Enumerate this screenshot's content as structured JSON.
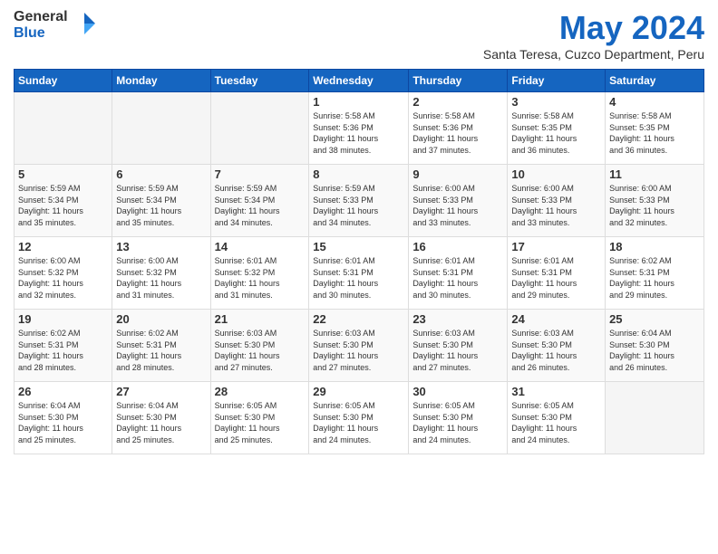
{
  "header": {
    "logo_line1": "General",
    "logo_line2": "Blue",
    "month_title": "May 2024",
    "location": "Santa Teresa, Cuzco Department, Peru"
  },
  "days_of_week": [
    "Sunday",
    "Monday",
    "Tuesday",
    "Wednesday",
    "Thursday",
    "Friday",
    "Saturday"
  ],
  "weeks": [
    [
      {
        "day": "",
        "info": ""
      },
      {
        "day": "",
        "info": ""
      },
      {
        "day": "",
        "info": ""
      },
      {
        "day": "1",
        "info": "Sunrise: 5:58 AM\nSunset: 5:36 PM\nDaylight: 11 hours\nand 38 minutes."
      },
      {
        "day": "2",
        "info": "Sunrise: 5:58 AM\nSunset: 5:36 PM\nDaylight: 11 hours\nand 37 minutes."
      },
      {
        "day": "3",
        "info": "Sunrise: 5:58 AM\nSunset: 5:35 PM\nDaylight: 11 hours\nand 36 minutes."
      },
      {
        "day": "4",
        "info": "Sunrise: 5:58 AM\nSunset: 5:35 PM\nDaylight: 11 hours\nand 36 minutes."
      }
    ],
    [
      {
        "day": "5",
        "info": "Sunrise: 5:59 AM\nSunset: 5:34 PM\nDaylight: 11 hours\nand 35 minutes."
      },
      {
        "day": "6",
        "info": "Sunrise: 5:59 AM\nSunset: 5:34 PM\nDaylight: 11 hours\nand 35 minutes."
      },
      {
        "day": "7",
        "info": "Sunrise: 5:59 AM\nSunset: 5:34 PM\nDaylight: 11 hours\nand 34 minutes."
      },
      {
        "day": "8",
        "info": "Sunrise: 5:59 AM\nSunset: 5:33 PM\nDaylight: 11 hours\nand 34 minutes."
      },
      {
        "day": "9",
        "info": "Sunrise: 6:00 AM\nSunset: 5:33 PM\nDaylight: 11 hours\nand 33 minutes."
      },
      {
        "day": "10",
        "info": "Sunrise: 6:00 AM\nSunset: 5:33 PM\nDaylight: 11 hours\nand 33 minutes."
      },
      {
        "day": "11",
        "info": "Sunrise: 6:00 AM\nSunset: 5:33 PM\nDaylight: 11 hours\nand 32 minutes."
      }
    ],
    [
      {
        "day": "12",
        "info": "Sunrise: 6:00 AM\nSunset: 5:32 PM\nDaylight: 11 hours\nand 32 minutes."
      },
      {
        "day": "13",
        "info": "Sunrise: 6:00 AM\nSunset: 5:32 PM\nDaylight: 11 hours\nand 31 minutes."
      },
      {
        "day": "14",
        "info": "Sunrise: 6:01 AM\nSunset: 5:32 PM\nDaylight: 11 hours\nand 31 minutes."
      },
      {
        "day": "15",
        "info": "Sunrise: 6:01 AM\nSunset: 5:31 PM\nDaylight: 11 hours\nand 30 minutes."
      },
      {
        "day": "16",
        "info": "Sunrise: 6:01 AM\nSunset: 5:31 PM\nDaylight: 11 hours\nand 30 minutes."
      },
      {
        "day": "17",
        "info": "Sunrise: 6:01 AM\nSunset: 5:31 PM\nDaylight: 11 hours\nand 29 minutes."
      },
      {
        "day": "18",
        "info": "Sunrise: 6:02 AM\nSunset: 5:31 PM\nDaylight: 11 hours\nand 29 minutes."
      }
    ],
    [
      {
        "day": "19",
        "info": "Sunrise: 6:02 AM\nSunset: 5:31 PM\nDaylight: 11 hours\nand 28 minutes."
      },
      {
        "day": "20",
        "info": "Sunrise: 6:02 AM\nSunset: 5:31 PM\nDaylight: 11 hours\nand 28 minutes."
      },
      {
        "day": "21",
        "info": "Sunrise: 6:03 AM\nSunset: 5:30 PM\nDaylight: 11 hours\nand 27 minutes."
      },
      {
        "day": "22",
        "info": "Sunrise: 6:03 AM\nSunset: 5:30 PM\nDaylight: 11 hours\nand 27 minutes."
      },
      {
        "day": "23",
        "info": "Sunrise: 6:03 AM\nSunset: 5:30 PM\nDaylight: 11 hours\nand 27 minutes."
      },
      {
        "day": "24",
        "info": "Sunrise: 6:03 AM\nSunset: 5:30 PM\nDaylight: 11 hours\nand 26 minutes."
      },
      {
        "day": "25",
        "info": "Sunrise: 6:04 AM\nSunset: 5:30 PM\nDaylight: 11 hours\nand 26 minutes."
      }
    ],
    [
      {
        "day": "26",
        "info": "Sunrise: 6:04 AM\nSunset: 5:30 PM\nDaylight: 11 hours\nand 25 minutes."
      },
      {
        "day": "27",
        "info": "Sunrise: 6:04 AM\nSunset: 5:30 PM\nDaylight: 11 hours\nand 25 minutes."
      },
      {
        "day": "28",
        "info": "Sunrise: 6:05 AM\nSunset: 5:30 PM\nDaylight: 11 hours\nand 25 minutes."
      },
      {
        "day": "29",
        "info": "Sunrise: 6:05 AM\nSunset: 5:30 PM\nDaylight: 11 hours\nand 24 minutes."
      },
      {
        "day": "30",
        "info": "Sunrise: 6:05 AM\nSunset: 5:30 PM\nDaylight: 11 hours\nand 24 minutes."
      },
      {
        "day": "31",
        "info": "Sunrise: 6:05 AM\nSunset: 5:30 PM\nDaylight: 11 hours\nand 24 minutes."
      },
      {
        "day": "",
        "info": ""
      }
    ]
  ]
}
